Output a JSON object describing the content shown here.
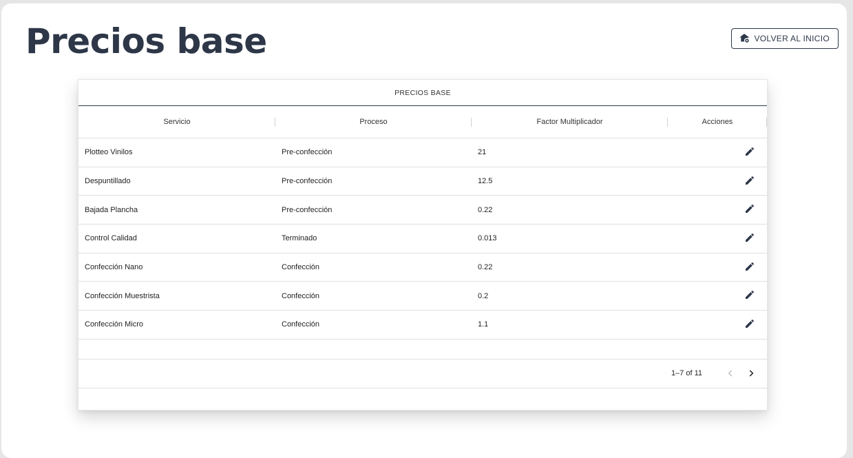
{
  "page": {
    "title": "Precios base"
  },
  "home_button": {
    "label": "VOLVER AL INICIO",
    "icon": "home-settings-icon"
  },
  "table": {
    "caption": "PRECIOS BASE",
    "columns": [
      "Servicio",
      "Proceso",
      "Factor Multiplicador",
      "Acciones"
    ],
    "rows": [
      {
        "servicio": "Plotteo Vinilos",
        "proceso": "Pre-confección",
        "factor": "21"
      },
      {
        "servicio": "Despuntillado",
        "proceso": "Pre-confección",
        "factor": "12.5"
      },
      {
        "servicio": "Bajada Plancha",
        "proceso": "Pre-confección",
        "factor": "0.22"
      },
      {
        "servicio": "Control Calidad",
        "proceso": "Terminado",
        "factor": "0.013"
      },
      {
        "servicio": "Confección Nano",
        "proceso": "Confección",
        "factor": "0.22"
      },
      {
        "servicio": "Confección Muestrista",
        "proceso": "Confección",
        "factor": "0.2"
      },
      {
        "servicio": "Confección Micro",
        "proceso": "Confección",
        "factor": "1.1"
      }
    ],
    "pagination": {
      "text": "1–7 of 11",
      "prev_enabled": false,
      "next_enabled": true
    }
  },
  "colors": {
    "primary": "#2d3748",
    "disabled": "#bdbdbd"
  }
}
